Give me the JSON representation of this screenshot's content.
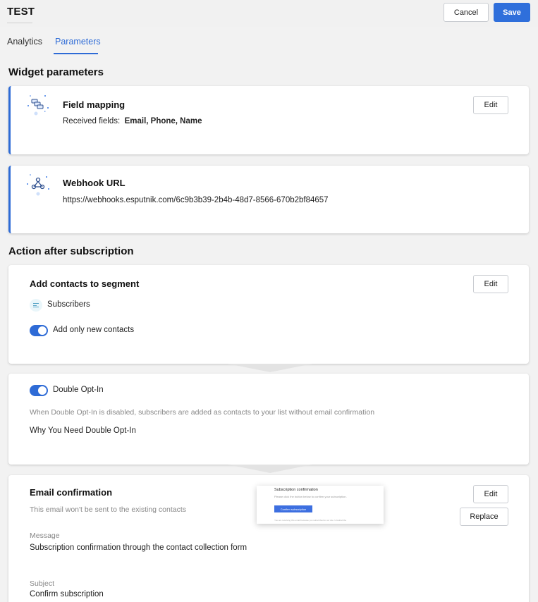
{
  "header": {
    "title": "TEST",
    "cancel_label": "Cancel",
    "save_label": "Save"
  },
  "tabs": [
    {
      "label": "Analytics",
      "active": false
    },
    {
      "label": "Parameters",
      "active": true
    }
  ],
  "widget_parameters": {
    "title": "Widget parameters",
    "field_mapping": {
      "title": "Field mapping",
      "received_label": "Received fields:",
      "received_value": "Email, Phone, Name",
      "edit_label": "Edit"
    },
    "webhook": {
      "title": "Webhook URL",
      "url": "https://webhooks.esputnik.com/6c9b3b39-2b4b-48d7-8566-670b2bf84657"
    }
  },
  "action_after": {
    "title": "Action after subscription",
    "segment": {
      "title": "Add contacts to segment",
      "segment_name": "Subscribers",
      "toggle_label": "Add only new contacts",
      "toggle_on": true,
      "edit_label": "Edit"
    },
    "double_opt_in": {
      "toggle_label": "Double Opt-In",
      "toggle_on": true,
      "hint": "When Double Opt-In is disabled, subscribers are added as contacts to your list without email confirmation",
      "link": "Why You Need Double Opt-In"
    },
    "email_confirmation": {
      "title": "Email confirmation",
      "hint": "This email won't be sent to the existing contacts",
      "message_label": "Message",
      "message_value": "Subscription confirmation through the contact collection form",
      "subject_label": "Subject",
      "subject_value": "Confirm subscription",
      "edit_label": "Edit",
      "replace_label": "Replace",
      "preview": {
        "title": "Subscription confirmation",
        "body": "Please click the button below to confirm your subscription.",
        "button": "Confirm subscription",
        "footer": "You are receiving this email because you subscribed to our site. Unsubscribe"
      }
    }
  },
  "colors": {
    "accent": "#2e6bd6",
    "primary_button": "#2f6fdb",
    "background": "#f2f2f2"
  }
}
